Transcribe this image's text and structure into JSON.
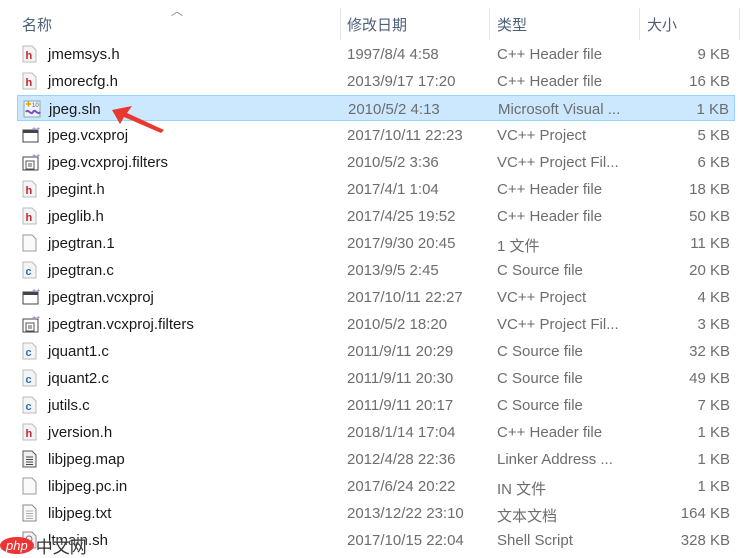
{
  "header": {
    "name": "名称",
    "date": "修改日期",
    "type": "类型",
    "size": "大小"
  },
  "files": [
    {
      "name": "jmemsys.h",
      "date": "1997/8/4 4:58",
      "type": "C++ Header file",
      "size": "9 KB",
      "icon": "h"
    },
    {
      "name": "jmorecfg.h",
      "date": "2013/9/17 17:20",
      "type": "C++ Header file",
      "size": "16 KB",
      "icon": "h"
    },
    {
      "name": "jpeg.sln",
      "date": "2010/5/2 4:13",
      "type": "Microsoft Visual ...",
      "size": "1 KB",
      "icon": "sln",
      "selected": true
    },
    {
      "name": "jpeg.vcxproj",
      "date": "2017/10/11 22:23",
      "type": "VC++ Project",
      "size": "5 KB",
      "icon": "proj"
    },
    {
      "name": "jpeg.vcxproj.filters",
      "date": "2010/5/2 3:36",
      "type": "VC++ Project Fil...",
      "size": "6 KB",
      "icon": "filters"
    },
    {
      "name": "jpegint.h",
      "date": "2017/4/1 1:04",
      "type": "C++ Header file",
      "size": "18 KB",
      "icon": "h"
    },
    {
      "name": "jpeglib.h",
      "date": "2017/4/25 19:52",
      "type": "C++ Header file",
      "size": "50 KB",
      "icon": "h"
    },
    {
      "name": "jpegtran.1",
      "date": "2017/9/30 20:45",
      "type": "1 文件",
      "size": "11 KB",
      "icon": "file"
    },
    {
      "name": "jpegtran.c",
      "date": "2013/9/5 2:45",
      "type": "C Source file",
      "size": "20 KB",
      "icon": "c"
    },
    {
      "name": "jpegtran.vcxproj",
      "date": "2017/10/11 22:27",
      "type": "VC++ Project",
      "size": "4 KB",
      "icon": "proj"
    },
    {
      "name": "jpegtran.vcxproj.filters",
      "date": "2010/5/2 18:20",
      "type": "VC++ Project Fil...",
      "size": "3 KB",
      "icon": "filters"
    },
    {
      "name": "jquant1.c",
      "date": "2011/9/11 20:29",
      "type": "C Source file",
      "size": "32 KB",
      "icon": "c"
    },
    {
      "name": "jquant2.c",
      "date": "2011/9/11 20:30",
      "type": "C Source file",
      "size": "49 KB",
      "icon": "c"
    },
    {
      "name": "jutils.c",
      "date": "2011/9/11 20:17",
      "type": "C Source file",
      "size": "7 KB",
      "icon": "c"
    },
    {
      "name": "jversion.h",
      "date": "2018/1/14 17:04",
      "type": "C++ Header file",
      "size": "1 KB",
      "icon": "h"
    },
    {
      "name": "libjpeg.map",
      "date": "2012/4/28 22:36",
      "type": "Linker Address ...",
      "size": "1 KB",
      "icon": "map"
    },
    {
      "name": "libjpeg.pc.in",
      "date": "2017/6/24 20:22",
      "type": "IN 文件",
      "size": "1 KB",
      "icon": "file"
    },
    {
      "name": "libjpeg.txt",
      "date": "2013/12/22 23:10",
      "type": "文本文档",
      "size": "164 KB",
      "icon": "txt"
    },
    {
      "name": "ltmain.sh",
      "date": "2017/10/15 22:04",
      "type": "Shell Script",
      "size": "328 KB",
      "icon": "sh"
    }
  ],
  "watermark": "php中文网"
}
